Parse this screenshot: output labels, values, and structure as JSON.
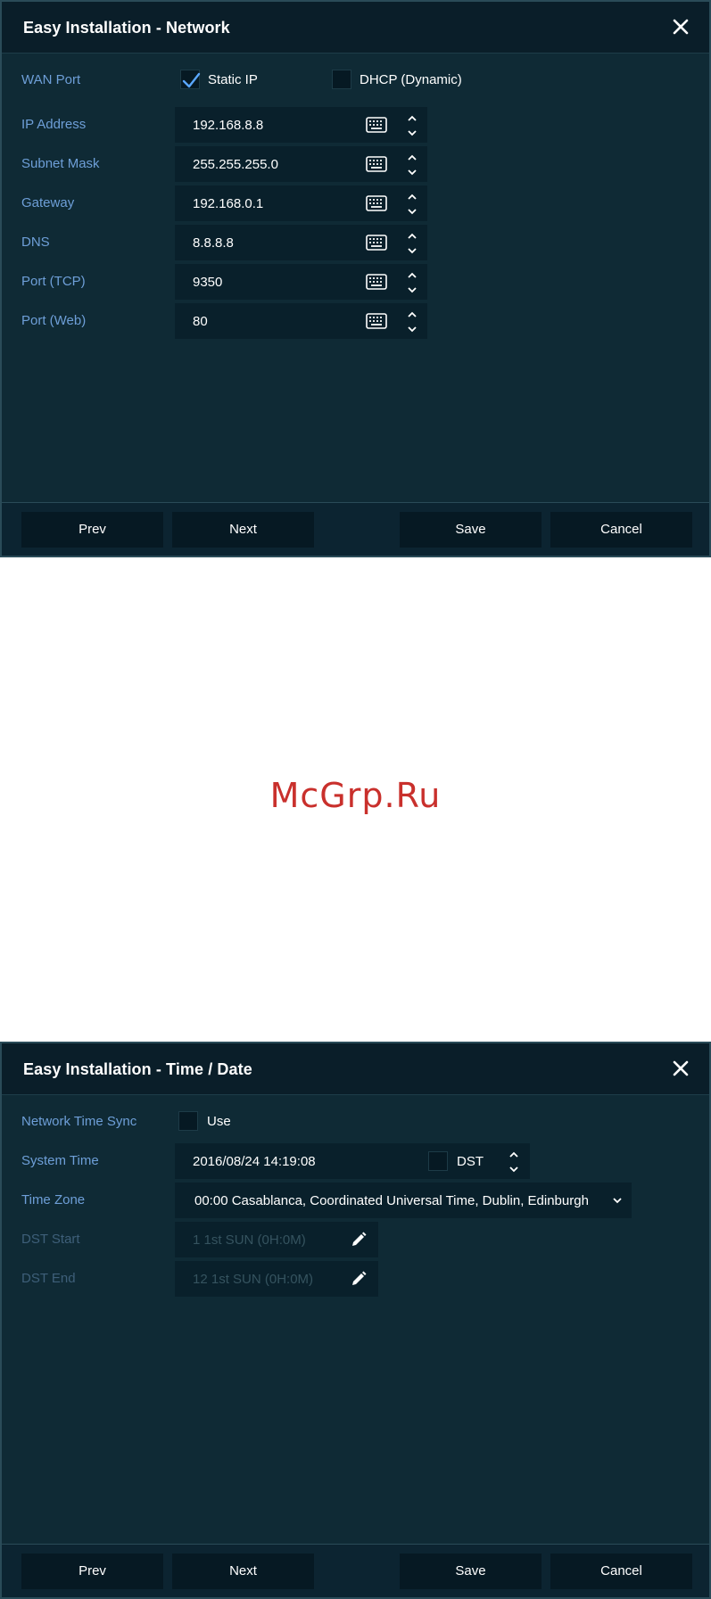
{
  "network_dialog": {
    "title": "Easy Installation - Network",
    "wan_port": {
      "label": "WAN Port",
      "static_ip_label": "Static IP",
      "static_ip_checked": true,
      "dhcp_label": "DHCP (Dynamic)",
      "dhcp_checked": false
    },
    "fields": [
      {
        "label": "IP Address",
        "value": "192.168.8.8"
      },
      {
        "label": "Subnet Mask",
        "value": "255.255.255.0"
      },
      {
        "label": "Gateway",
        "value": "192.168.0.1"
      },
      {
        "label": "DNS",
        "value": "8.8.8.8"
      },
      {
        "label": "Port (TCP)",
        "value": "9350"
      },
      {
        "label": "Port (Web)",
        "value": "80"
      }
    ],
    "buttons": {
      "prev": "Prev",
      "next": "Next",
      "save": "Save",
      "cancel": "Cancel"
    }
  },
  "watermark": "McGrp.Ru",
  "time_dialog": {
    "title": "Easy Installation - Time / Date",
    "network_time_sync": {
      "label": "Network Time Sync",
      "use_label": "Use",
      "checked": false
    },
    "system_time": {
      "label": "System Time",
      "value": "2016/08/24 14:19:08",
      "dst_label": "DST",
      "dst_checked": false
    },
    "time_zone": {
      "label": "Time Zone",
      "value": "00:00 Casablanca, Coordinated Universal Time, Dublin, Edinburgh"
    },
    "dst_start": {
      "label": "DST Start",
      "value": "1 1st SUN (0H:0M)"
    },
    "dst_end": {
      "label": "DST End",
      "value": "12 1st SUN (0H:0M)"
    },
    "buttons": {
      "prev": "Prev",
      "next": "Next",
      "save": "Save",
      "cancel": "Cancel"
    }
  },
  "colors": {
    "dialog_bg": "#0f2a35",
    "titlebar_bg": "#0a1e29",
    "label": "#6e9fd8",
    "field_bg": "#09202b",
    "button_bg": "#061923",
    "watermark": "#c9302c"
  }
}
